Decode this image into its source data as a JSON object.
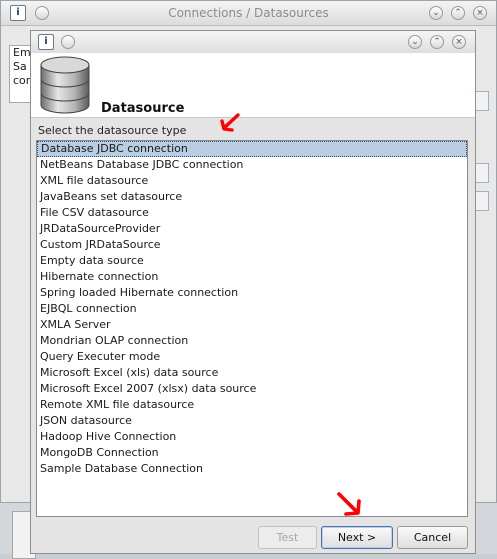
{
  "back_window": {
    "title": "Connections / Datasources",
    "list_items": [
      "Em",
      "Sa",
      "cor"
    ]
  },
  "dialog": {
    "header_title": "Datasource",
    "section_label": "Select the datasource type",
    "datasource_types": [
      "Database JDBC connection",
      "NetBeans Database JDBC connection",
      "XML file datasource",
      "JavaBeans set datasource",
      "File CSV datasource",
      "JRDataSourceProvider",
      "Custom JRDataSource",
      "Empty data source",
      "Hibernate connection",
      "Spring loaded Hibernate connection",
      "EJBQL connection",
      "XMLA Server",
      "Mondrian OLAP connection",
      "Query Executer mode",
      "Microsoft Excel (xls) data source",
      "Microsoft Excel 2007 (xlsx) data source",
      "Remote XML file datasource",
      "JSON datasource",
      "Hadoop Hive Connection",
      "MongoDB Connection",
      "Sample Database Connection"
    ],
    "selected_index": 0,
    "buttons": {
      "test": "Test",
      "next": "Next >",
      "cancel": "Cancel"
    }
  },
  "window_controls": {
    "minimize": "⌄",
    "maximize": "⌃",
    "close": "×"
  },
  "colors": {
    "selection": "#b9cde3",
    "annotation_arrow": "#ff0000"
  }
}
